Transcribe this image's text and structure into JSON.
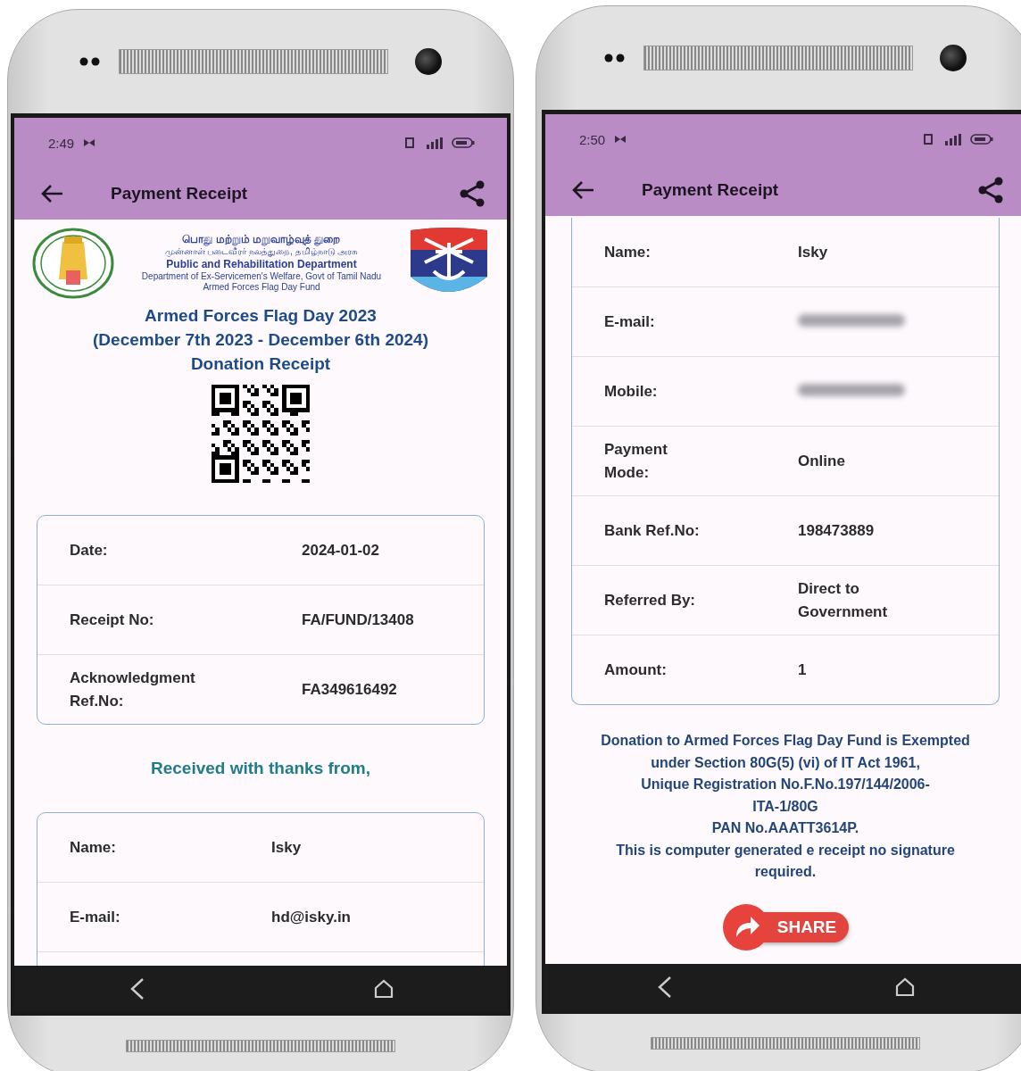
{
  "phones": [
    {
      "status_bar": {
        "time": "2:49"
      },
      "app_bar": {
        "title": "Payment Receipt"
      },
      "receipt_header": {
        "tamil_lines": [
          "பொது மற்றும் மறுவாழ்வுத் துறை",
          "முன்னாள் படைவீரர் நலத்துறை, தமிழ்நாடு அரசு"
        ],
        "english_lines": [
          "Public and Rehabilitation Department",
          "Department of  Ex-Servicemen's  Welfare, Govt of  Tamil Nadu",
          "Armed Forces Flag Day Fund"
        ]
      },
      "titles": [
        "Armed Forces Flag Day 2023",
        "(December 7th 2023 - December 6th 2024)",
        "Donation Receipt"
      ],
      "info_card": {
        "rows": [
          {
            "label": "Date:",
            "value": "2024-01-02",
            "blurred": false
          },
          {
            "label": "Receipt No:",
            "value": "FA/FUND/13408",
            "blurred": false
          },
          {
            "label": "Acknowledgment Ref.No:",
            "value": "FA349616492",
            "blurred": false
          }
        ]
      },
      "thanks_text": "Received with thanks from,",
      "donor_card": {
        "rows": [
          {
            "label": "Name:",
            "value": "Isky",
            "blurred": false
          },
          {
            "label": "E-mail:",
            "value": "hd@isky.in",
            "blurred": false
          }
        ]
      }
    },
    {
      "status_bar": {
        "time": "2:50"
      },
      "app_bar": {
        "title": "Payment Receipt"
      },
      "donor_card": {
        "rows": [
          {
            "label": "Name:",
            "value": "Isky",
            "blurred": false
          },
          {
            "label": "E-mail:",
            "blurred": true
          },
          {
            "label": "Mobile:",
            "blurred": true
          },
          {
            "label": "Payment Mode:",
            "value": "Online",
            "blurred": false
          },
          {
            "label": "Bank Ref.No:",
            "value": "198473889",
            "blurred": false
          },
          {
            "label": "Referred By:",
            "value": "Direct to Government",
            "blurred": false
          },
          {
            "label": "Amount:",
            "value": "1",
            "blurred": false
          }
        ]
      },
      "notice_lines": [
        "Donation to Armed Forces Flag Day Fund is Exempted",
        "under Section 80G(5) (vi) of IT Act 1961,",
        "Unique Registration No.F.No.197/144/2006-",
        "ITA-1/80G",
        "PAN No.AAATT3614P.",
        "This is computer generated e receipt no signature",
        "required."
      ],
      "share_button": {
        "label": "SHARE"
      }
    }
  ]
}
